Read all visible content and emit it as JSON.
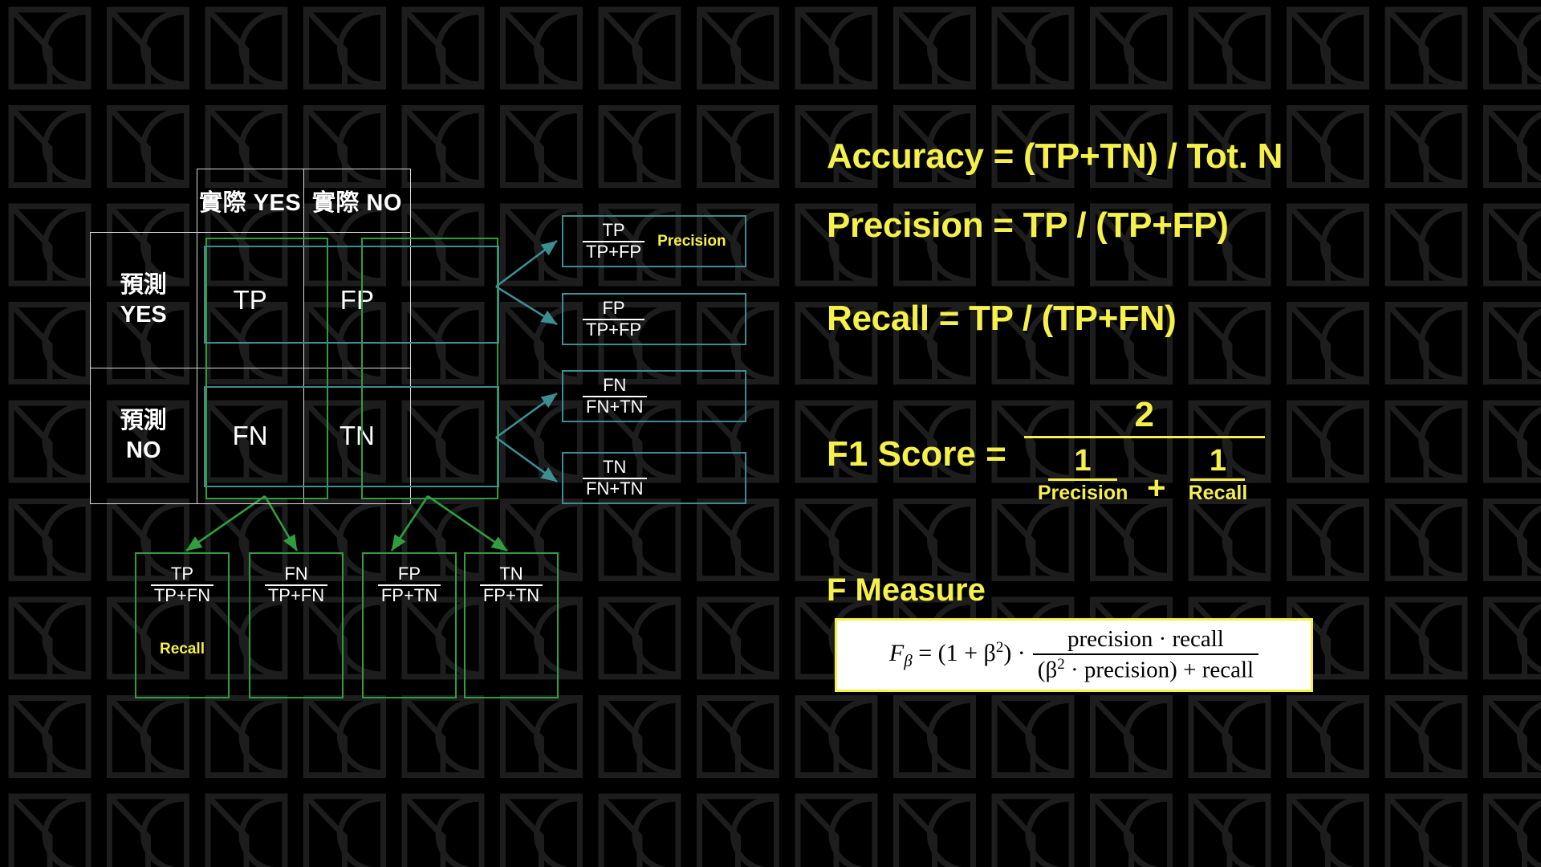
{
  "background": {
    "pattern_name": "tiled-logo-watermark",
    "tile_color": "#1c1c1c",
    "page_color": "#000000"
  },
  "colors": {
    "accent_yellow": "#f5f04a",
    "green": "#2f9e3f",
    "teal": "#3d8e92",
    "white": "#ffffff"
  },
  "matrix": {
    "corner": "",
    "col_headers": [
      "實際 YES",
      "實際 NO"
    ],
    "row_headers": [
      {
        "line1": "預測",
        "line2": "YES"
      },
      {
        "line1": "預測",
        "line2": "NO"
      }
    ],
    "cells": [
      [
        "TP",
        "FP"
      ],
      [
        "FN",
        "TN"
      ]
    ]
  },
  "row_metric_boxes": [
    {
      "name": "precision-box",
      "num": "TP",
      "den": "TP+FP",
      "tag": "Precision"
    },
    {
      "name": "fp-rate-box",
      "num": "FP",
      "den": "TP+FP",
      "tag": ""
    },
    {
      "name": "fn-ratio-box",
      "num": "FN",
      "den": "FN+TN",
      "tag": ""
    },
    {
      "name": "npv-box",
      "num": "TN",
      "den": "FN+TN",
      "tag": ""
    }
  ],
  "col_metric_boxes": [
    {
      "name": "recall-box",
      "num": "TP",
      "den": "TP+FN",
      "tag": "Recall"
    },
    {
      "name": "miss-rate-box",
      "num": "FN",
      "den": "TP+FN",
      "tag": ""
    },
    {
      "name": "fallout-box",
      "num": "FP",
      "den": "FP+TN",
      "tag": ""
    },
    {
      "name": "specificity-box",
      "num": "TN",
      "den": "FP+TN",
      "tag": ""
    }
  ],
  "formulas": {
    "accuracy": "Accuracy = (TP+TN) / Tot. N",
    "precision": "Precision = TP / (TP+FP)",
    "recall": "Recall = TP / (TP+FN)",
    "f1": {
      "label": "F1 Score =",
      "numerator": "2",
      "term1_num": "1",
      "term1_den": "Precision",
      "operator": "+",
      "term2_num": "1",
      "term2_den": "Recall"
    },
    "f_measure": {
      "title": "F Measure",
      "lhs": "F",
      "lhs_sub": "β",
      "equals": "= (1 + β",
      "equals_sup": "2",
      "equals_tail": ") ·",
      "frac_num": "precision · recall",
      "frac_den_open": "(β",
      "frac_den_sup": "2",
      "frac_den_tail": " · precision) + recall"
    }
  }
}
